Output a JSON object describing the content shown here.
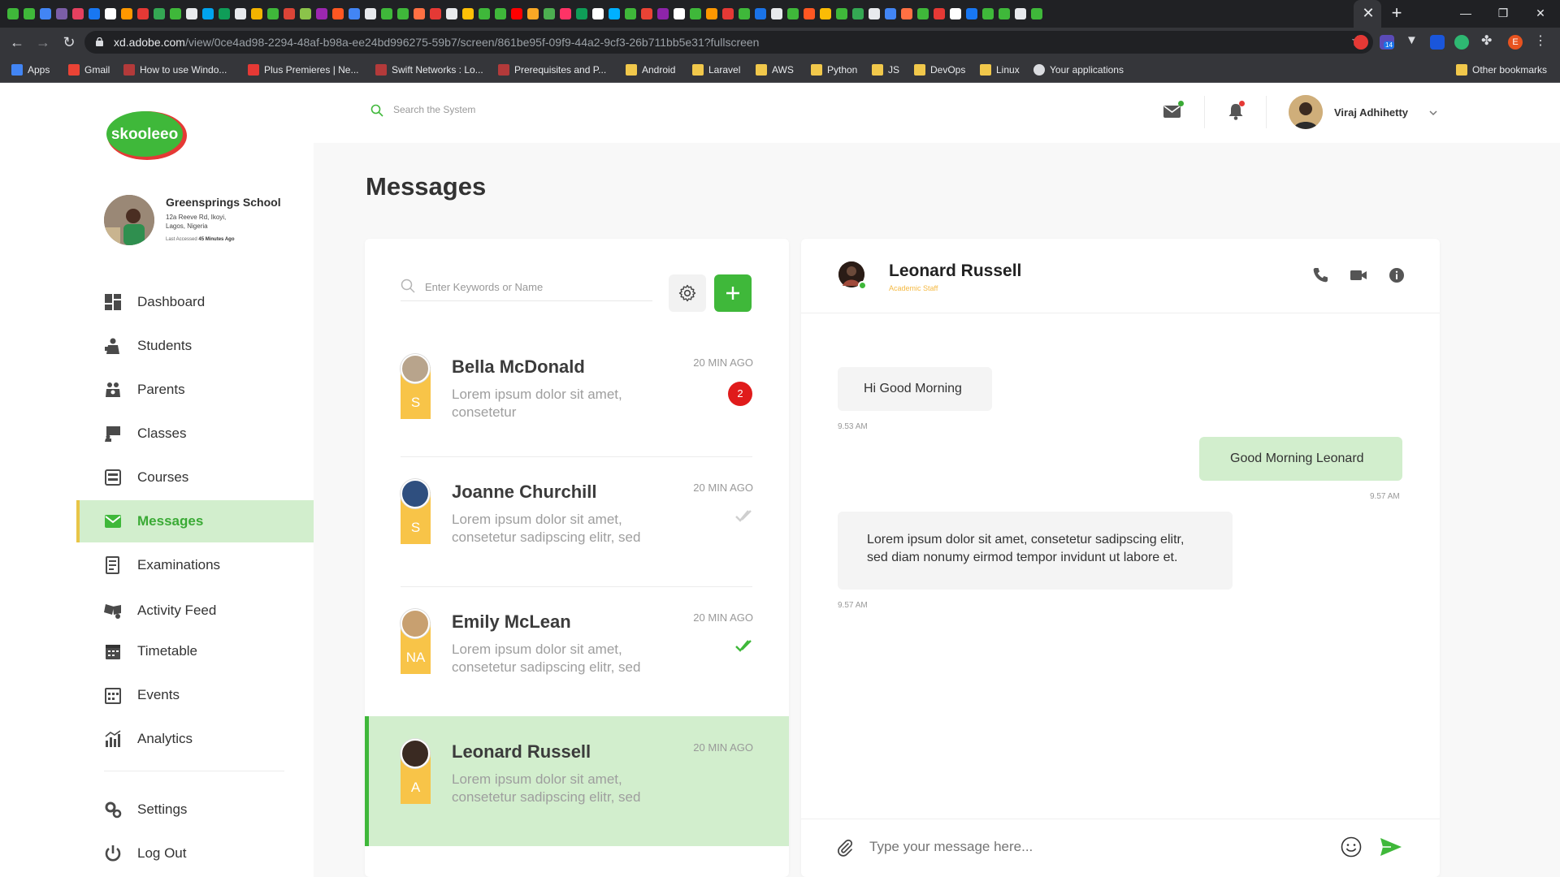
{
  "browser": {
    "url_domain": "xd.adobe.com",
    "url_path": "/view/0ce4ad98-2294-48af-b98a-ee24bd996275-59b7/screen/861be95f-09f9-44a2-9cf3-26b711bb5e31?fullscreen",
    "bookmarks": [
      {
        "label": "Apps",
        "icon": "apps-grid-icon"
      },
      {
        "label": "Gmail",
        "icon": "gmail-icon"
      },
      {
        "label": "How to use Windo...",
        "icon": "site-icon"
      },
      {
        "label": "Plus Premieres | Ne...",
        "icon": "chart-site-icon"
      },
      {
        "label": "Swift Networks : Lo...",
        "icon": "site-icon"
      },
      {
        "label": "Prerequisites and P...",
        "icon": "site-icon"
      },
      {
        "label": "Android",
        "icon": "folder-icon"
      },
      {
        "label": "Laravel",
        "icon": "folder-icon"
      },
      {
        "label": "AWS",
        "icon": "folder-icon"
      },
      {
        "label": "Python",
        "icon": "folder-icon"
      },
      {
        "label": "JS",
        "icon": "folder-icon"
      },
      {
        "label": "DevOps",
        "icon": "folder-icon"
      },
      {
        "label": "Linux",
        "icon": "folder-icon"
      },
      {
        "label": "Your applications",
        "icon": "globe-icon"
      }
    ],
    "other_bookmarks": "Other bookmarks",
    "profile_initial": "E",
    "extension_badge": "14"
  },
  "sidebar": {
    "logo_text": "skooleeo",
    "school": {
      "name": "Greensprings School",
      "address_line1": "12a Reeve Rd, Ikoyi,",
      "address_line2": "Lagos, Nigeria",
      "access_prefix": "Last Accessed",
      "access_value": "45 Minutes Ago"
    },
    "nav": [
      {
        "label": "Dashboard",
        "icon": "dashboard-icon",
        "active": false
      },
      {
        "label": "Students",
        "icon": "students-icon",
        "active": false
      },
      {
        "label": "Parents",
        "icon": "parents-icon",
        "active": false
      },
      {
        "label": "Classes",
        "icon": "classes-icon",
        "active": false
      },
      {
        "label": "Courses",
        "icon": "courses-icon",
        "active": false
      },
      {
        "label": "Messages",
        "icon": "messages-icon",
        "active": true
      },
      {
        "label": "Examinations",
        "icon": "examinations-icon",
        "active": false
      },
      {
        "label": "Activity Feed",
        "icon": "activity-feed-icon",
        "active": false
      },
      {
        "label": "Timetable",
        "icon": "timetable-icon",
        "active": false
      },
      {
        "label": "Events",
        "icon": "events-icon",
        "active": false
      },
      {
        "label": "Analytics",
        "icon": "analytics-icon",
        "active": false
      }
    ],
    "bottom_nav": [
      {
        "label": "Settings",
        "icon": "settings-icon"
      },
      {
        "label": "Log Out",
        "icon": "logout-icon"
      }
    ]
  },
  "header": {
    "search_placeholder": "Search the System",
    "user_name": "Viraj Adhihetty"
  },
  "page": {
    "title": "Messages"
  },
  "conversation_list": {
    "search_placeholder": "Enter Keywords or Name",
    "items": [
      {
        "name": "Bella McDonald",
        "preview_line1": "Lorem ipsum dolor sit amet,",
        "preview_line2": "consetetur",
        "time": "20 MIN AGO",
        "tag": "S",
        "status": "unread",
        "badge": "2"
      },
      {
        "name": "Joanne Churchill",
        "preview_line1": "Lorem ipsum dolor sit amet,",
        "preview_line2": "consetetur sadipscing elitr, sed",
        "time": "20 MIN AGO",
        "tag": "S",
        "status": "delivered"
      },
      {
        "name": "Emily McLean",
        "preview_line1": "Lorem ipsum dolor sit amet,",
        "preview_line2": "consetetur sadipscing elitr, sed",
        "time": "20 MIN AGO",
        "tag": "NA",
        "status": "read"
      },
      {
        "name": "Leonard Russell",
        "preview_line1": "Lorem ipsum dolor sit amet,",
        "preview_line2": "consetetur sadipscing elitr, sed",
        "time": "20 MIN AGO",
        "tag": "A",
        "status": "active"
      }
    ]
  },
  "chat": {
    "contact_name": "Leonard Russell",
    "contact_role": "Academic Staff",
    "messages": [
      {
        "direction": "in",
        "text": "Hi Good Morning",
        "time": "9.53 AM"
      },
      {
        "direction": "out",
        "text": "Good Morning Leonard",
        "time": "9.57 AM"
      },
      {
        "direction": "in",
        "text_line1": "Lorem ipsum dolor sit amet, consetetur sadipscing elitr,",
        "text_line2": "sed diam nonumy eirmod tempor invidunt ut labore et.",
        "time": "9.57 AM"
      }
    ],
    "composer_placeholder": "Type your message here..."
  },
  "colors": {
    "brand_green": "#3fb83a",
    "active_bg": "#d2eecd",
    "tag_yellow": "#f8c448",
    "accent_orange": "#f5b942",
    "badge_red": "#e01b1b"
  }
}
